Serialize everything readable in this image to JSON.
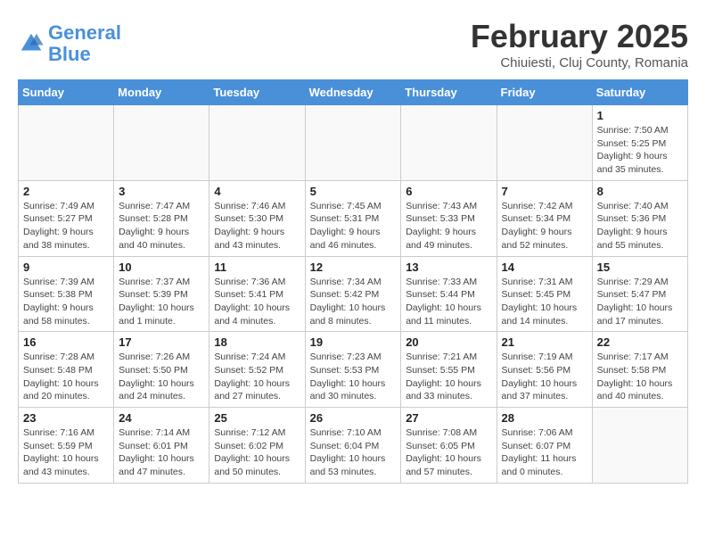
{
  "header": {
    "logo_line1": "General",
    "logo_line2": "Blue",
    "month": "February 2025",
    "location": "Chiuiesti, Cluj County, Romania"
  },
  "weekdays": [
    "Sunday",
    "Monday",
    "Tuesday",
    "Wednesday",
    "Thursday",
    "Friday",
    "Saturday"
  ],
  "weeks": [
    [
      {
        "day": null,
        "info": null
      },
      {
        "day": null,
        "info": null
      },
      {
        "day": null,
        "info": null
      },
      {
        "day": null,
        "info": null
      },
      {
        "day": null,
        "info": null
      },
      {
        "day": null,
        "info": null
      },
      {
        "day": "1",
        "info": "Sunrise: 7:50 AM\nSunset: 5:25 PM\nDaylight: 9 hours and 35 minutes."
      }
    ],
    [
      {
        "day": "2",
        "info": "Sunrise: 7:49 AM\nSunset: 5:27 PM\nDaylight: 9 hours and 38 minutes."
      },
      {
        "day": "3",
        "info": "Sunrise: 7:47 AM\nSunset: 5:28 PM\nDaylight: 9 hours and 40 minutes."
      },
      {
        "day": "4",
        "info": "Sunrise: 7:46 AM\nSunset: 5:30 PM\nDaylight: 9 hours and 43 minutes."
      },
      {
        "day": "5",
        "info": "Sunrise: 7:45 AM\nSunset: 5:31 PM\nDaylight: 9 hours and 46 minutes."
      },
      {
        "day": "6",
        "info": "Sunrise: 7:43 AM\nSunset: 5:33 PM\nDaylight: 9 hours and 49 minutes."
      },
      {
        "day": "7",
        "info": "Sunrise: 7:42 AM\nSunset: 5:34 PM\nDaylight: 9 hours and 52 minutes."
      },
      {
        "day": "8",
        "info": "Sunrise: 7:40 AM\nSunset: 5:36 PM\nDaylight: 9 hours and 55 minutes."
      }
    ],
    [
      {
        "day": "9",
        "info": "Sunrise: 7:39 AM\nSunset: 5:38 PM\nDaylight: 9 hours and 58 minutes."
      },
      {
        "day": "10",
        "info": "Sunrise: 7:37 AM\nSunset: 5:39 PM\nDaylight: 10 hours and 1 minute."
      },
      {
        "day": "11",
        "info": "Sunrise: 7:36 AM\nSunset: 5:41 PM\nDaylight: 10 hours and 4 minutes."
      },
      {
        "day": "12",
        "info": "Sunrise: 7:34 AM\nSunset: 5:42 PM\nDaylight: 10 hours and 8 minutes."
      },
      {
        "day": "13",
        "info": "Sunrise: 7:33 AM\nSunset: 5:44 PM\nDaylight: 10 hours and 11 minutes."
      },
      {
        "day": "14",
        "info": "Sunrise: 7:31 AM\nSunset: 5:45 PM\nDaylight: 10 hours and 14 minutes."
      },
      {
        "day": "15",
        "info": "Sunrise: 7:29 AM\nSunset: 5:47 PM\nDaylight: 10 hours and 17 minutes."
      }
    ],
    [
      {
        "day": "16",
        "info": "Sunrise: 7:28 AM\nSunset: 5:48 PM\nDaylight: 10 hours and 20 minutes."
      },
      {
        "day": "17",
        "info": "Sunrise: 7:26 AM\nSunset: 5:50 PM\nDaylight: 10 hours and 24 minutes."
      },
      {
        "day": "18",
        "info": "Sunrise: 7:24 AM\nSunset: 5:52 PM\nDaylight: 10 hours and 27 minutes."
      },
      {
        "day": "19",
        "info": "Sunrise: 7:23 AM\nSunset: 5:53 PM\nDaylight: 10 hours and 30 minutes."
      },
      {
        "day": "20",
        "info": "Sunrise: 7:21 AM\nSunset: 5:55 PM\nDaylight: 10 hours and 33 minutes."
      },
      {
        "day": "21",
        "info": "Sunrise: 7:19 AM\nSunset: 5:56 PM\nDaylight: 10 hours and 37 minutes."
      },
      {
        "day": "22",
        "info": "Sunrise: 7:17 AM\nSunset: 5:58 PM\nDaylight: 10 hours and 40 minutes."
      }
    ],
    [
      {
        "day": "23",
        "info": "Sunrise: 7:16 AM\nSunset: 5:59 PM\nDaylight: 10 hours and 43 minutes."
      },
      {
        "day": "24",
        "info": "Sunrise: 7:14 AM\nSunset: 6:01 PM\nDaylight: 10 hours and 47 minutes."
      },
      {
        "day": "25",
        "info": "Sunrise: 7:12 AM\nSunset: 6:02 PM\nDaylight: 10 hours and 50 minutes."
      },
      {
        "day": "26",
        "info": "Sunrise: 7:10 AM\nSunset: 6:04 PM\nDaylight: 10 hours and 53 minutes."
      },
      {
        "day": "27",
        "info": "Sunrise: 7:08 AM\nSunset: 6:05 PM\nDaylight: 10 hours and 57 minutes."
      },
      {
        "day": "28",
        "info": "Sunrise: 7:06 AM\nSunset: 6:07 PM\nDaylight: 11 hours and 0 minutes."
      },
      {
        "day": null,
        "info": null
      }
    ]
  ]
}
